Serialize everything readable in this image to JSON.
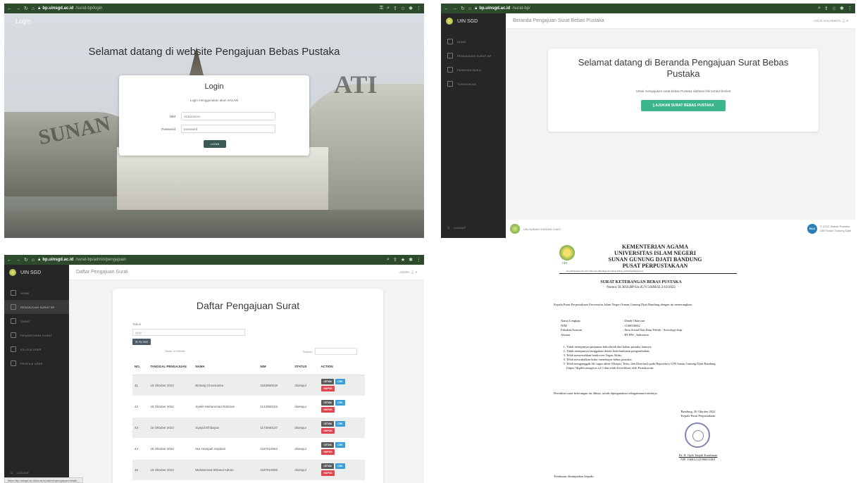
{
  "login_screen": {
    "browser": {
      "url_host": "bp.uinsgd.ac.id",
      "url_path": "/surat-bp/login"
    },
    "corner_label": "Login",
    "heading": "Selamat datang di website Pengajuan Bebas Pustaka",
    "gate_text_left": "SUNAN",
    "gate_text_right": "ATI",
    "card": {
      "title": "Login",
      "subtitle": "Login menggunakan akun SALAM",
      "nim_label": "NIM",
      "nim_value": "113xxxxxxx",
      "password_label": "Password",
      "password_value": "password",
      "button": "LOGIN"
    }
  },
  "home_screen": {
    "browser": {
      "url_host": "bp.uinsgd.ac.id",
      "url_path": "/surat-bp/"
    },
    "brand": "UIN SGD",
    "nav": [
      "HOME",
      "PENGAJUAN SURAT BP",
      "PANDUAN BUKU",
      "TUNGGAKAN"
    ],
    "logout": "LOGOUT",
    "topbar_title": "Beranda Pengajuan Surat Bebas Pustaka",
    "user": "AGUS SULAEMAN",
    "welcome_title": "Selamat datang di Beranda Pengajuan Surat Bebas Pustaka",
    "welcome_sub": "Untuk mengajukan surat bebas Pustaka silahkan klik tombol berikut",
    "welcome_button": "AJUKAN SURAT BEBAS PUSTAKA",
    "footer_left": "UIN SUNAN GUNUNG DJATI",
    "footer_badge": "BLU",
    "footer_right_1": "© 2022, Bebas Pustaka",
    "footer_right_2": "UIN Sunan Gunung Djati"
  },
  "admin_screen": {
    "browser": {
      "url_host": "bp.uinsgd.ac.id",
      "url_path": "/surat-bp/admin/pengajuan"
    },
    "brand": "UIN SGD",
    "nav": [
      "HOME",
      "PENGAJUAN SURAT BP",
      "SURAT",
      "PENGATURAN SURAT",
      "KELOLA USER",
      "PROFILE USER"
    ],
    "logout": "LOGOUT",
    "topbar_title": "Daftar Pengajuan Surat",
    "user": "ADMIN",
    "card_title": "Daftar Pengajuan Surat",
    "tahun_label": "Tahun",
    "tahun_placeholder": "yyyy",
    "filter_button": "FILTER",
    "show_entries": "Show 10 entries",
    "search_label": "Search:",
    "columns": [
      "NO.",
      "TANGGAL PENGAJUAN",
      "NAMA",
      "NIM",
      "STATUS",
      "ACTION"
    ],
    "rows": [
      [
        "41",
        "18 Oktober 2022",
        "Bintang Choerunisa",
        "1183060019",
        "disetujui"
      ],
      [
        "42",
        "18 Oktober 2022",
        "Syekh Muhammad Rahman",
        "1143050152",
        "disetujui"
      ],
      [
        "43",
        "18 Oktober 2022",
        "Syayid Efridayan",
        "1173050137",
        "disetujui"
      ],
      [
        "44",
        "18 Oktober 2022",
        "Nur Hanipah Septiani",
        "1187010063",
        "disetujui"
      ],
      [
        "45",
        "18 Oktober 2022",
        "Muhammad Ikhlasul Adnan",
        "1187010055",
        "disetujui"
      ]
    ],
    "btn_cetak": "CETAK",
    "btn_cek": "CEK",
    "btn_hapus": "HAPUS"
  },
  "document": {
    "header_1": "KEMENTERIAN AGAMA",
    "header_2": "UNIVERSITAS ISLAM NEGERI",
    "header_3": "SUNAN GUNUNG DJATI BANDUNG",
    "header_4": "PUSAT PERPUSTAKAAN",
    "seal_label": "UIN",
    "address": "Jln A.H.Nasution No.105 Cibiru Kota Bandung Jawa Barat 40614 e-mail lib@uinsgd.ac.id",
    "title": "SURAT KETERANGAN BEBAS PUSTAKA",
    "nomor": "Nomor: B.3656.BP/Un.05/V.5/HM.02.2/10/2022",
    "intro": "Kepala Pusat Perpustakaan Universitas Islam Negeri Sunan Gunung Djati Bandung dengan ini menerangkan:",
    "fields": [
      [
        "Nama Lengkap",
        ": Dandi Oktavian"
      ],
      [
        "NIM",
        ": 1168030042"
      ],
      [
        "Fakultas/Jurusan",
        ": Ilmu Sosial Dan Ilmu Politik / Sosiologi-fisip"
      ],
      [
        "Alamat",
        ": RT RW , Indonesia"
      ]
    ],
    "points": [
      "Tidak mempunyai pinjaman buku/kitab dan bahan pustaka lainnya;",
      "Tidak mempunyai tunggakan denda keterlambatan pengembalian;",
      "Telah menyerahkan hardcover Tugas Akhir;",
      "Telah mewakafkan buku /membayar bebas pustaka;",
      "Telah mengunggah file tugas akhir (Skripsi, Tesis, dan Disertasi) pada Repository UIN Sunan Gunung Djati Bandung (https://digilib.uinsgd.ac.id/ ) dan telah diverifikasi oleh Pustakawan."
    ],
    "closing": "Demikian surat keterangan ini dibuat, untuk dipergunakan sebagaimana mestinya.",
    "sign_place_date": "Bandung, 26 Oktober 2022",
    "sign_role": "Kepala Pusat Perpustakaan",
    "sign_name": "Dr. H. Opik Taupik Kurahman",
    "sign_nip": "NIP. 196812141996031001",
    "tembusan": "Tembusan disampaikan kepada :"
  },
  "colors": {
    "chrome": "#2d4a2c",
    "sidebar": "#262626",
    "accent_green": "#3bb58a",
    "btn_red": "#e0444f",
    "btn_blue": "#3aa0d8"
  }
}
